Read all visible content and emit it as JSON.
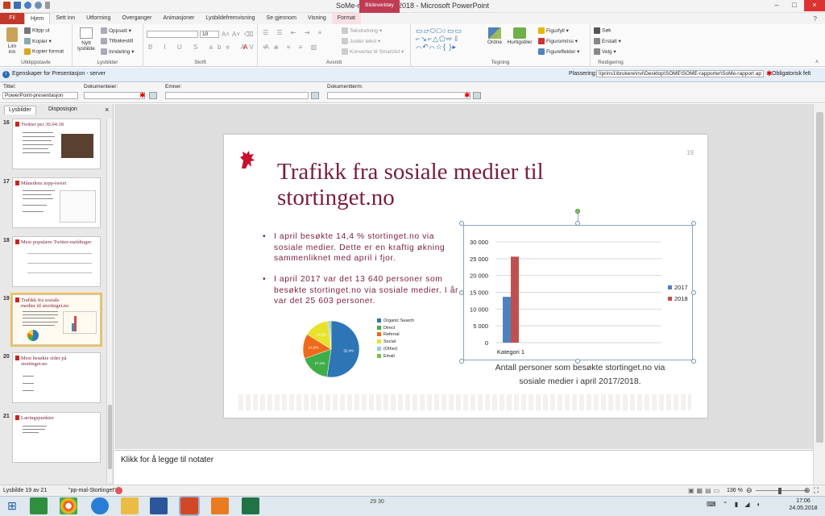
{
  "window": {
    "title": "SoMe-rapport april 2018 - Microsoft PowerPoint",
    "context_tab": "Bildeverktøy"
  },
  "tabs": [
    "Fil",
    "Hjem",
    "Sett inn",
    "Utforming",
    "Overganger",
    "Animasjoner",
    "Lysbildefremvisning",
    "Se gjennom",
    "Visning",
    "Format"
  ],
  "ribbon": {
    "clipboard": {
      "paste": "Lim inn",
      "cut": "Klipp ut",
      "copy": "Kopier",
      "format_painter": "Kopier format",
      "label": "Utklippstavle"
    },
    "slides": {
      "new_slide": "Nytt lysbilde",
      "layout": "Oppsett",
      "reset": "Tilbakestill",
      "section": "Inndeling",
      "label": "Lysbilder"
    },
    "font": {
      "size": "10",
      "label": "Skrift"
    },
    "paragraph": {
      "text_direction": "Tekstretning",
      "align_text": "Juster tekst",
      "smartart": "Konverter til SmartArt",
      "label": "Avsnitt"
    },
    "drawing": {
      "arrange": "Ordne",
      "quick_styles": "Hurtigstiler",
      "fill": "Figurfyll",
      "outline": "Figuromriss",
      "effects": "Figureffekter",
      "label": "Tegning"
    },
    "editing": {
      "find": "Søk",
      "replace": "Erstatt",
      "select": "Velg",
      "label": "Redigering"
    }
  },
  "property_bar": {
    "title": "Egenskaper for Presentasjon - server",
    "location_label": "Plassering:",
    "location_value": "\\\\prins1\\brukere\\nvi\\Desktop\\SOME\\SOME-rapporter\\SoMe-rapport ap",
    "required_label": "Obligatorisk felt"
  },
  "doc_props": {
    "title_label": "Tittel:",
    "title_value": "PowerPoint-presentasjon",
    "owner_label": "Dokumenteier:",
    "topics_label": "Emner:",
    "term_label": "Dokumentterm:"
  },
  "left_panel": {
    "tab_slides": "Lysbilder",
    "tab_outline": "Disposisjon",
    "close": "×",
    "slides": [
      {
        "num": "16",
        "title": "Twitter per 30.04.18"
      },
      {
        "num": "17",
        "title": "Månedens topp-tweet"
      },
      {
        "num": "18",
        "title": "Mest populære Twitter-meldinger"
      },
      {
        "num": "19",
        "title": "Trafikk fra sosiale medier til stortinget.no"
      },
      {
        "num": "20",
        "title": "Mest besøkte sider på stortinget.no"
      },
      {
        "num": "21",
        "title": "Læringspunkter"
      }
    ]
  },
  "slide": {
    "number": "19",
    "title": "Trafikk fra sosiale medier til stortinget.no",
    "bullets": [
      "I april besøkte 14,4 % stortinget.no via sosiale medier. Dette er en kraftig økning sammenliknet med april i fjor.",
      "I april 2017 var det 13 640 personer som besøkte stortinget.no via sosiale medier. I år var det 25 603 personer."
    ],
    "caption": "Antall personer som besøkte stortinget.no via sosiale medier i april 2017/2018."
  },
  "chart_data": [
    {
      "type": "bar",
      "categories": [
        "Kategori 1"
      ],
      "series": [
        {
          "name": "2017",
          "values": [
            13640
          ],
          "color": "#4f81bd"
        },
        {
          "name": "2018",
          "values": [
            25603
          ],
          "color": "#c0504d"
        }
      ],
      "ylim": [
        0,
        30000
      ],
      "yticks": [
        "0",
        "5 000",
        "10 000",
        "15 000",
        "20 000",
        "25 000",
        "30 000"
      ],
      "grid": true,
      "legend": "right"
    },
    {
      "type": "pie",
      "labels": [
        "Organic Search",
        "Direct",
        "Referral",
        "Social",
        "(Other)",
        "Email"
      ],
      "values": [
        52.4,
        17.1,
        14.3,
        14.3,
        1.2,
        0.7
      ],
      "value_labels": [
        "52,4%",
        "17,1%",
        "14,3%",
        "14,3%",
        "",
        ""
      ],
      "colors": [
        "#2e75b6",
        "#3fae49",
        "#ef6a1a",
        "#e8e22a",
        "#97c8ea",
        "#7ac142"
      ],
      "legend": "right"
    }
  ],
  "notes": {
    "placeholder": "Klikk for å legge til notater"
  },
  "status": {
    "slide_info": "Lysbilde 19 av 21",
    "theme": "\"pp-mal-Stortinget\"",
    "zoom": "136 %"
  },
  "taskbar": {
    "time": "17:06",
    "date": "24.05.2018",
    "pages": "29 30"
  }
}
